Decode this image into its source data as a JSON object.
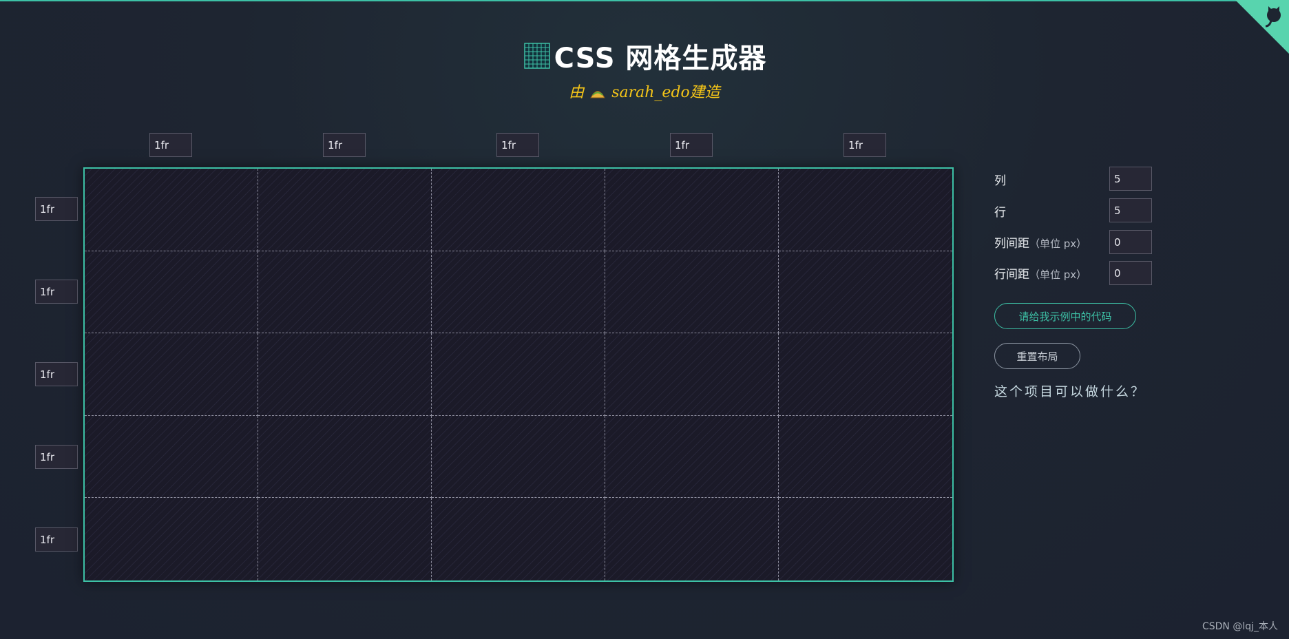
{
  "header": {
    "title": "CSS 网格生成器",
    "subtitle_prefix": "由",
    "subtitle_author": "sarah_edo",
    "subtitle_suffix": "建造"
  },
  "grid": {
    "columns": [
      "1fr",
      "1fr",
      "1fr",
      "1fr",
      "1fr"
    ],
    "rows": [
      "1fr",
      "1fr",
      "1fr",
      "1fr",
      "1fr"
    ]
  },
  "controls": {
    "columns_label": "列",
    "columns_value": "5",
    "rows_label": "行",
    "rows_value": "5",
    "column_gap_label": "列间距",
    "column_gap_unit": "（单位 px）",
    "column_gap_value": "0",
    "row_gap_label": "行间距",
    "row_gap_unit": "（单位 px）",
    "row_gap_value": "0"
  },
  "buttons": {
    "code": "请给我示例中的代码",
    "reset": "重置布局"
  },
  "help_link": "这个项目可以做什么？",
  "watermark": "CSDN @lqj_本人",
  "colors": {
    "accent": "#3dc1a6",
    "background": "#1e2531",
    "subtitle": "#f5c518",
    "corner": "#58d4ae"
  },
  "icons": [
    "grid-logo-icon",
    "taco-icon",
    "github-octocat-icon"
  ]
}
